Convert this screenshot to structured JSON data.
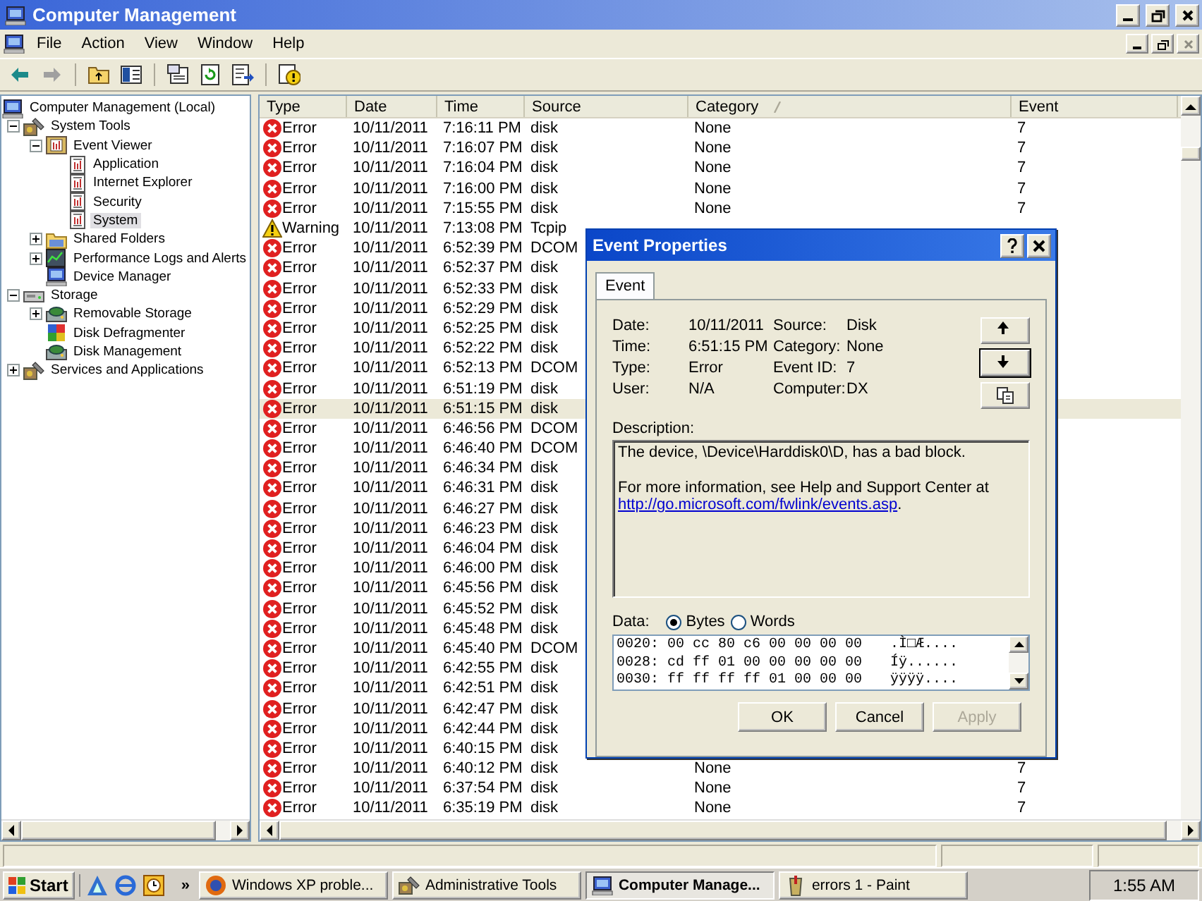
{
  "window": {
    "title": "Computer Management"
  },
  "menu": [
    {
      "label": "File"
    },
    {
      "label": "Action"
    },
    {
      "label": "View"
    },
    {
      "label": "Window"
    },
    {
      "label": "Help"
    }
  ],
  "tree": [
    {
      "label": "Computer Management (Local)",
      "selected": false,
      "children": [
        {
          "label": "System Tools",
          "expanded": true,
          "selected": false,
          "children": [
            {
              "label": "Event Viewer",
              "expanded": true,
              "selected": false,
              "children": [
                {
                  "label": "Application",
                  "selected": false
                },
                {
                  "label": "Internet Explorer",
                  "selected": false
                },
                {
                  "label": "Security",
                  "selected": false
                },
                {
                  "label": "System",
                  "selected": true
                }
              ]
            },
            {
              "label": "Shared Folders",
              "expanded": false,
              "selected": false
            },
            {
              "label": "Performance Logs and Alerts",
              "expanded": false,
              "selected": false
            },
            {
              "label": "Device Manager",
              "selected": false
            }
          ]
        },
        {
          "label": "Storage",
          "expanded": true,
          "selected": false,
          "children": [
            {
              "label": "Removable Storage",
              "expanded": false,
              "selected": false
            },
            {
              "label": "Disk Defragmenter",
              "selected": false
            },
            {
              "label": "Disk Management",
              "selected": false
            }
          ]
        },
        {
          "label": "Services and Applications",
          "expanded": false,
          "selected": false
        }
      ]
    }
  ],
  "list": {
    "columns": [
      {
        "label": "Type",
        "sorted": false
      },
      {
        "label": "Date",
        "sorted": false
      },
      {
        "label": "Time",
        "sorted": false
      },
      {
        "label": "Source",
        "sorted": false
      },
      {
        "label": "Category",
        "sorted": true
      },
      {
        "label": "Event",
        "sorted": false
      }
    ],
    "rows": [
      {
        "kind": "error",
        "type": "Error",
        "date": "10/11/2011",
        "time": "7:16:11 PM",
        "source": "disk",
        "category": "None",
        "event": "7",
        "selected": false
      },
      {
        "kind": "error",
        "type": "Error",
        "date": "10/11/2011",
        "time": "7:16:07 PM",
        "source": "disk",
        "category": "None",
        "event": "7",
        "selected": false
      },
      {
        "kind": "error",
        "type": "Error",
        "date": "10/11/2011",
        "time": "7:16:04 PM",
        "source": "disk",
        "category": "None",
        "event": "7",
        "selected": false
      },
      {
        "kind": "error",
        "type": "Error",
        "date": "10/11/2011",
        "time": "7:16:00 PM",
        "source": "disk",
        "category": "None",
        "event": "7",
        "selected": false
      },
      {
        "kind": "error",
        "type": "Error",
        "date": "10/11/2011",
        "time": "7:15:55 PM",
        "source": "disk",
        "category": "None",
        "event": "7",
        "selected": false
      },
      {
        "kind": "warning",
        "type": "Warning",
        "date": "10/11/2011",
        "time": "7:13:08 PM",
        "source": "Tcpip",
        "selected": false
      },
      {
        "kind": "error",
        "type": "Error",
        "date": "10/11/2011",
        "time": "6:52:39 PM",
        "source": "DCOM",
        "selected": false
      },
      {
        "kind": "error",
        "type": "Error",
        "date": "10/11/2011",
        "time": "6:52:37 PM",
        "source": "disk",
        "selected": false
      },
      {
        "kind": "error",
        "type": "Error",
        "date": "10/11/2011",
        "time": "6:52:33 PM",
        "source": "disk",
        "selected": false
      },
      {
        "kind": "error",
        "type": "Error",
        "date": "10/11/2011",
        "time": "6:52:29 PM",
        "source": "disk",
        "selected": false
      },
      {
        "kind": "error",
        "type": "Error",
        "date": "10/11/2011",
        "time": "6:52:25 PM",
        "source": "disk",
        "selected": false
      },
      {
        "kind": "error",
        "type": "Error",
        "date": "10/11/2011",
        "time": "6:52:22 PM",
        "source": "disk",
        "selected": false
      },
      {
        "kind": "error",
        "type": "Error",
        "date": "10/11/2011",
        "time": "6:52:13 PM",
        "source": "DCOM",
        "selected": false
      },
      {
        "kind": "error",
        "type": "Error",
        "date": "10/11/2011",
        "time": "6:51:19 PM",
        "source": "disk",
        "selected": false
      },
      {
        "kind": "error",
        "type": "Error",
        "date": "10/11/2011",
        "time": "6:51:15 PM",
        "source": "disk",
        "selected": true
      },
      {
        "kind": "error",
        "type": "Error",
        "date": "10/11/2011",
        "time": "6:46:56 PM",
        "source": "DCOM",
        "selected": false
      },
      {
        "kind": "error",
        "type": "Error",
        "date": "10/11/2011",
        "time": "6:46:40 PM",
        "source": "DCOM",
        "selected": false
      },
      {
        "kind": "error",
        "type": "Error",
        "date": "10/11/2011",
        "time": "6:46:34 PM",
        "source": "disk",
        "selected": false
      },
      {
        "kind": "error",
        "type": "Error",
        "date": "10/11/2011",
        "time": "6:46:31 PM",
        "source": "disk",
        "selected": false
      },
      {
        "kind": "error",
        "type": "Error",
        "date": "10/11/2011",
        "time": "6:46:27 PM",
        "source": "disk",
        "selected": false
      },
      {
        "kind": "error",
        "type": "Error",
        "date": "10/11/2011",
        "time": "6:46:23 PM",
        "source": "disk",
        "selected": false
      },
      {
        "kind": "error",
        "type": "Error",
        "date": "10/11/2011",
        "time": "6:46:04 PM",
        "source": "disk",
        "selected": false
      },
      {
        "kind": "error",
        "type": "Error",
        "date": "10/11/2011",
        "time": "6:46:00 PM",
        "source": "disk",
        "selected": false
      },
      {
        "kind": "error",
        "type": "Error",
        "date": "10/11/2011",
        "time": "6:45:56 PM",
        "source": "disk",
        "selected": false
      },
      {
        "kind": "error",
        "type": "Error",
        "date": "10/11/2011",
        "time": "6:45:52 PM",
        "source": "disk",
        "selected": false
      },
      {
        "kind": "error",
        "type": "Error",
        "date": "10/11/2011",
        "time": "6:45:48 PM",
        "source": "disk",
        "selected": false
      },
      {
        "kind": "error",
        "type": "Error",
        "date": "10/11/2011",
        "time": "6:45:40 PM",
        "source": "DCOM",
        "selected": false
      },
      {
        "kind": "error",
        "type": "Error",
        "date": "10/11/2011",
        "time": "6:42:55 PM",
        "source": "disk",
        "selected": false
      },
      {
        "kind": "error",
        "type": "Error",
        "date": "10/11/2011",
        "time": "6:42:51 PM",
        "source": "disk",
        "selected": false
      },
      {
        "kind": "error",
        "type": "Error",
        "date": "10/11/2011",
        "time": "6:42:47 PM",
        "source": "disk",
        "selected": false
      },
      {
        "kind": "error",
        "type": "Error",
        "date": "10/11/2011",
        "time": "6:42:44 PM",
        "source": "disk",
        "selected": false
      },
      {
        "kind": "error",
        "type": "Error",
        "date": "10/11/2011",
        "time": "6:40:15 PM",
        "source": "disk",
        "selected": false
      },
      {
        "kind": "error",
        "type": "Error",
        "date": "10/11/2011",
        "time": "6:40:12 PM",
        "source": "disk",
        "category": "None",
        "event": "7",
        "selected": false
      },
      {
        "kind": "error",
        "type": "Error",
        "date": "10/11/2011",
        "time": "6:37:54 PM",
        "source": "disk",
        "category": "None",
        "event": "7",
        "selected": false
      },
      {
        "kind": "error",
        "type": "Error",
        "date": "10/11/2011",
        "time": "6:35:19 PM",
        "source": "disk",
        "category": "None",
        "event": "7",
        "selected": false
      }
    ]
  },
  "dialog": {
    "title": "Event Properties",
    "tabs": [
      {
        "label": "Event",
        "selected": true
      }
    ],
    "fields": [
      {
        "label": "Date:",
        "value": "10/11/2011"
      },
      {
        "label": "Source:",
        "value": "Disk"
      },
      {
        "label": "Time:",
        "value": "6:51:15 PM"
      },
      {
        "label": "Category:",
        "value": "None"
      },
      {
        "label": "Type:",
        "value": "Error"
      },
      {
        "label": "Event ID:",
        "value": "7"
      },
      {
        "label": "User:",
        "value": "N/A"
      },
      {
        "label": "Computer:",
        "value": "DX"
      }
    ],
    "description_label": "Description:",
    "description": [
      {
        "text": "The device, \\Device\\Harddisk0\\D, has a bad block."
      },
      {
        "text": "For more information, see Help and Support Center at",
        "link": "http://go.microsoft.com/fwlink/events.asp",
        "after": "."
      }
    ],
    "data_label": "Data:",
    "data_format": [
      {
        "label": "Bytes",
        "selected": true
      },
      {
        "label": "Words",
        "selected": false
      }
    ],
    "data_lines": [
      {
        "offset": "0020:",
        "bytes": "00 cc 80 c6 00 00 00 00",
        "chars": ".Ì□Æ...."
      },
      {
        "offset": "0028:",
        "bytes": "cd ff 01 00 00 00 00 00",
        "chars": "Íÿ......"
      },
      {
        "offset": "0030:",
        "bytes": "ff ff ff ff 01 00 00 00",
        "chars": "ÿÿÿÿ...."
      }
    ],
    "buttons": [
      {
        "label": "OK",
        "disabled": false
      },
      {
        "label": "Cancel",
        "disabled": false
      },
      {
        "label": "Apply",
        "disabled": true
      }
    ]
  },
  "taskbar": {
    "start": "Start",
    "more": "»",
    "tasks": [
      {
        "label": "Windows XP proble...",
        "selected": false
      },
      {
        "label": "Administrative Tools",
        "selected": false
      },
      {
        "label": "Computer Manage...",
        "selected": true
      },
      {
        "label": "errors 1 - Paint",
        "selected": false
      }
    ],
    "clock": "1:55 AM"
  }
}
